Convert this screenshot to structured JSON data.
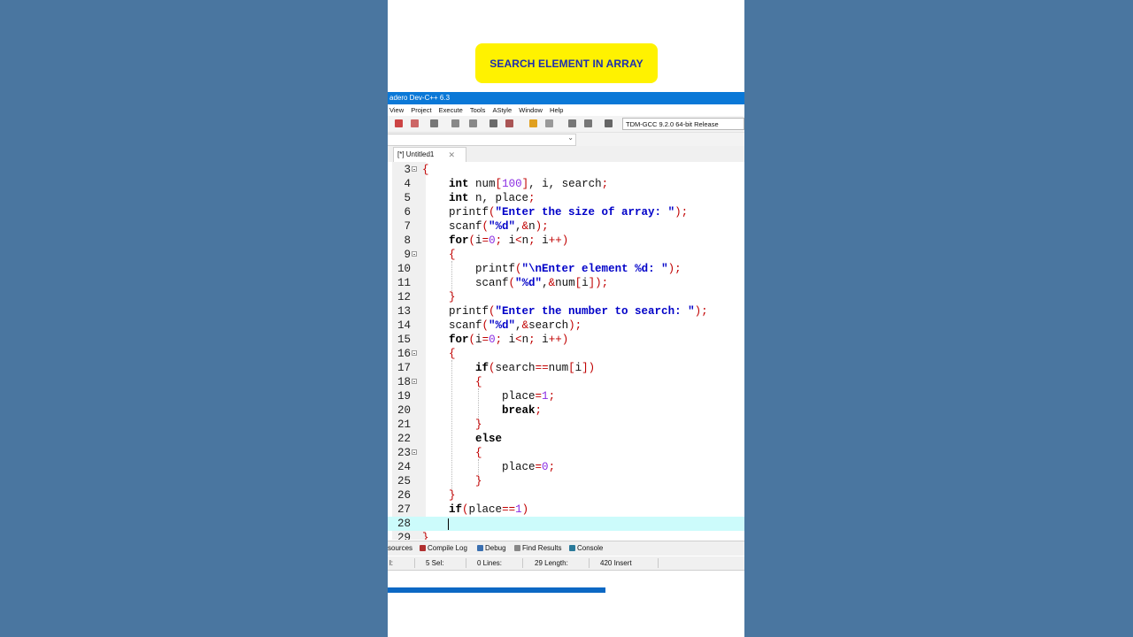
{
  "overlay": {
    "title": "SEARCH ELEMENT IN ARRAY"
  },
  "window": {
    "title": "adero Dev-C++ 6.3"
  },
  "menu": [
    "View",
    "Project",
    "Execute",
    "Tools",
    "AStyle",
    "Window",
    "Help"
  ],
  "toolbar": {
    "compiler": "TDM-GCC 9.2.0 64-bit Release"
  },
  "tabs": [
    {
      "label": "[*] Untitled1"
    }
  ],
  "editor": {
    "current_line": 28
  },
  "bottom_tabs": [
    "sources",
    "Compile Log",
    "Debug",
    "Find Results",
    "Console"
  ],
  "status": {
    "line_label": "l:",
    "sel": "5 Sel:",
    "lines": "0 Lines:",
    "length": "29 Length:",
    "insert": "420 Insert"
  },
  "colors": {
    "background": "#4a76a0",
    "badge": "#fff200",
    "badge_text": "#1d2fb0",
    "titlebar": "#0a78d7",
    "current_line": "#ccfbfb",
    "string": "#0000c8",
    "symbol": "#c00000",
    "number": "#8a2be2",
    "progress": "#0c68c4"
  }
}
